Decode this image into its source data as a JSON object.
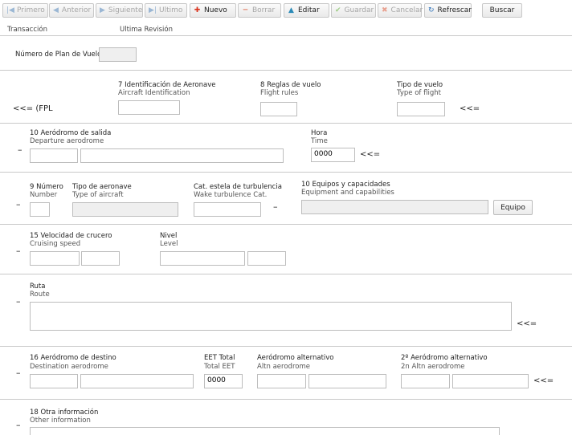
{
  "toolbar": {
    "primero": "Primero",
    "anterior": "Anterior",
    "siguiente": "Siguiente",
    "ultimo": "Ultimo",
    "nuevo": "Nuevo",
    "borrar": "Borrar",
    "editar": "Editar",
    "guardar": "Guardar",
    "cancelar": "Cancelar",
    "refrescar": "Refrescar",
    "buscar": "Buscar"
  },
  "header": {
    "transaccion": "Transacción",
    "ultima_revision": "Ultima Revisión"
  },
  "plan": {
    "label": "Número de Plan de Vuelo",
    "value": ""
  },
  "row1": {
    "prefix": "<<= (FPL",
    "ident_label": "7 Identificación de Aeronave",
    "ident_sub": "Aircraft Identification",
    "rules_label": "8 Reglas de vuelo",
    "rules_sub": "Flight rules",
    "type_label": "Tipo de vuelo",
    "type_sub": "Type of flight",
    "suffix": "<<="
  },
  "row2": {
    "dash": "–",
    "dep_label": "10 Aeródromo de salida",
    "dep_sub": "Departure aerodrome",
    "hora_label": "Hora",
    "hora_sub": "Time",
    "hora_value": "0000",
    "suffix": "<<="
  },
  "row3": {
    "dash": "–",
    "num_label": "9 Número",
    "num_sub": "Number",
    "acft_label": "Tipo de aeronave",
    "acft_sub": "Type of aircraft",
    "wake_label": "Cat. estela de turbulencia",
    "wake_sub": "Wake turbulence Cat.",
    "dash2": "–",
    "equip_label": "10 Equipos y capacidades",
    "equip_sub": "Equipment and capabilities",
    "equip_button": "Equipo"
  },
  "row4": {
    "dash": "–",
    "speed_label": "15 Velocidad de crucero",
    "speed_sub": "Cruising speed",
    "level_label": "Nivel",
    "level_sub": "Level"
  },
  "row5": {
    "dash": "–",
    "route_label": "Ruta",
    "route_sub": "Route",
    "suffix": "<<="
  },
  "row6": {
    "dash": "–",
    "dest_label": "16 Aeródromo de destino",
    "dest_sub": "Destination aerodrome",
    "eet_label": "EET Total",
    "eet_sub": "Total EET",
    "eet_value": "0000",
    "alt_label": "Aeródromo alternativo",
    "alt_sub": "Altn aerodrome",
    "alt2_label": "2º Aeródromo alternativo",
    "alt2_sub": "2n Altn aerodrome",
    "suffix": "<<="
  },
  "row7": {
    "dash": "–",
    "other_label": "18 Otra información",
    "other_sub": "Other information"
  },
  "colors": {
    "nuevo_icon": "#d9341e",
    "editar_icon": "#2a8ab7",
    "guardar_icon": "#5aa02c",
    "cancel_icon": "#d9341e",
    "refresh_icon": "#2a6fb7"
  }
}
